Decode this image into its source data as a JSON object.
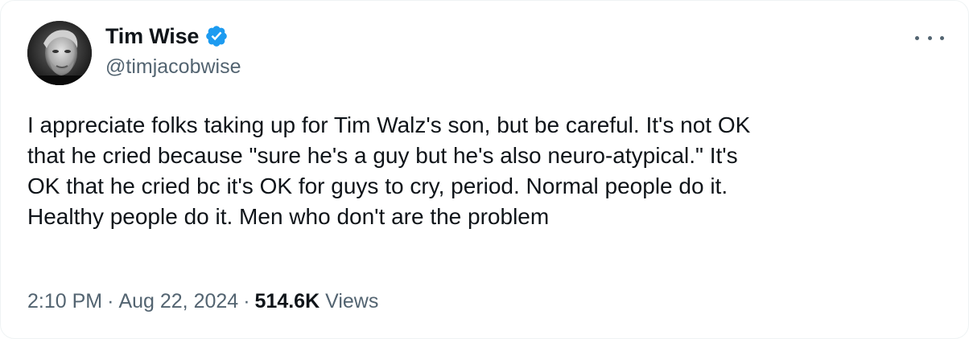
{
  "author": {
    "name": "Tim Wise",
    "handle": "@timjacobwise",
    "verified": true,
    "avatar_icon": "profile-photo"
  },
  "menu_icon": "more-options-icon",
  "tweet": {
    "text": "I appreciate folks taking up for Tim Walz's son, but be careful. It's not OK\nthat he cried because \"sure he's a guy but he's also neuro-atypical.\" It's\nOK that he cried bc it's OK for guys to cry, period. Normal people do it.\nHealthy people do it. Men who don't are the problem",
    "time": "2:10 PM",
    "date": "Aug 22, 2024",
    "separator": "·",
    "views_count": "514.6K",
    "views_label": "Views"
  },
  "colors": {
    "text": "#0f1419",
    "secondary": "#536471",
    "verified_badge": "#1d9bf0"
  }
}
